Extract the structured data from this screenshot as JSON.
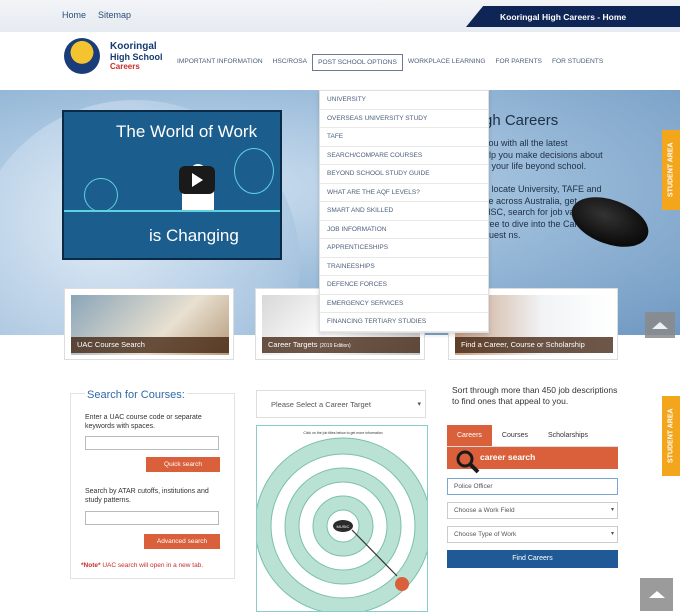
{
  "topbar": {
    "links": [
      "Home",
      "Sitemap"
    ],
    "title": "Kooringal High Careers - Home"
  },
  "logo": {
    "line1": "Kooringal",
    "line2": "High School",
    "line3": "Careers"
  },
  "nav": {
    "items": [
      "IMPORTANT INFORMATION",
      "HSC/ROSA",
      "POST SCHOOL OPTIONS",
      "WORKPLACE LEARNING",
      "FOR PARENTS",
      "FOR STUDENTS"
    ]
  },
  "dropdown": {
    "items": [
      "UNIVERSITY",
      "OVERSEAS UNIVERSITY STUDY",
      "TAFE",
      "SEARCH/COMPARE COURSES",
      "BEYOND SCHOOL STUDY GUIDE",
      "WHAT ARE THE AQF LEVELS?",
      "SMART AND SKILLED",
      "JOB INFORMATION",
      "APPRENTICESHIPS",
      "TRAINEESHIPS",
      "DEFENCE FORCES",
      "EMERGENCY SERVICES",
      "FINANCING TERTIARY STUDIES"
    ]
  },
  "hero": {
    "video_title_line1": "The World of Work",
    "video_title_line2": "is Changing",
    "heading": "gh Careers",
    "text_lines": [
      "you with all the latest",
      "elp you make decisions about",
      "d your life beyond school.",
      "",
      "o locate University, TAFE and",
      "se across Australia, get",
      "HSC, search for job vacancies",
      "free to dive into the Careers",
      "quest ns."
    ]
  },
  "side_tabs": {
    "top": "STUDENT AREA",
    "bottom": "STUDENT AREA"
  },
  "cards": [
    {
      "label": "UAC Course Search",
      "small": ""
    },
    {
      "label": "Career Targets",
      "small": "(2019 Edition)"
    },
    {
      "label": "Find a Career, Course or Scholarship",
      "small": ""
    }
  ],
  "uac_search": {
    "title": "Search for Courses:",
    "desc1": "Enter a UAC course code or separate keywords with spaces.",
    "quick_button": "Quick search",
    "desc2": "Search by ATAR cutoffs, institutions and study patterns.",
    "advanced_button": "Advanced search",
    "note_bold": "*Note*",
    "note_text": " UAC search will open in a new tab."
  },
  "career_target": {
    "select_placeholder": "Please Select a Career Target",
    "chart_header": "Click on the job titles below to get more information",
    "center_label": "MUSIC"
  },
  "career_search": {
    "intro": "Sort through more than 450 job descriptions to find ones that appeal to you.",
    "tabs": [
      "Careers",
      "Courses",
      "Scholarships"
    ],
    "bar_label": "career search",
    "input_value": "Police Officer",
    "work_field": "Choose a Work Field",
    "type_of_work": "Choose Type of Work",
    "find_button": "Find Careers"
  },
  "colors": {
    "navy": "#0f2555",
    "orange": "#d9603b",
    "accent_orange": "#f3a51b",
    "blue_button": "#1f5a96"
  }
}
